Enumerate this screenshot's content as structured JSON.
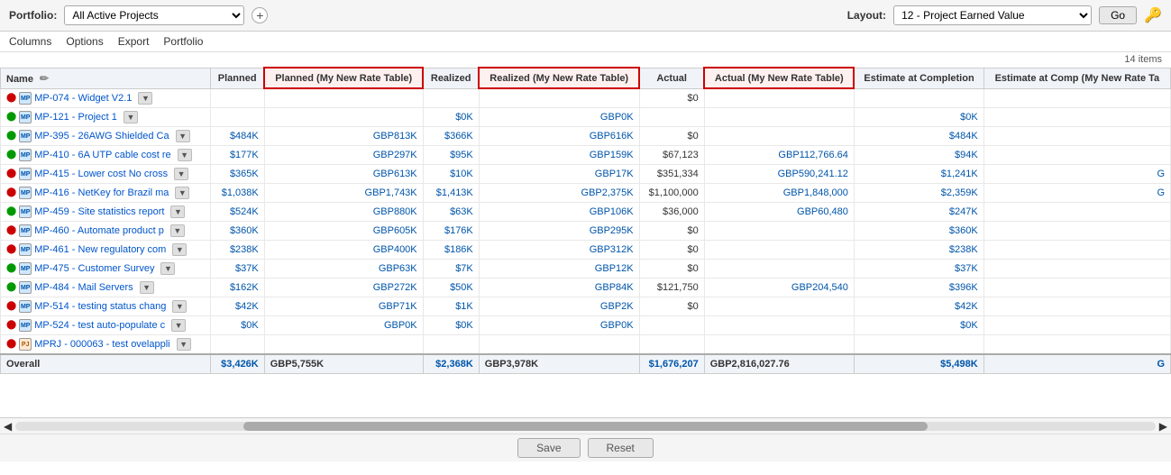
{
  "topBar": {
    "portfolioLabel": "Portfolio:",
    "portfolioValue": "All Active Projects",
    "layoutLabel": "Layout:",
    "layoutValue": "12 - Project Earned Value",
    "goLabel": "Go",
    "plusTitle": "Add"
  },
  "toolbar": {
    "items": [
      "Columns",
      "Options",
      "Export",
      "Portfolio"
    ]
  },
  "itemsCount": "14 items",
  "tableHeaders": {
    "name": "Name",
    "planned": "Planned",
    "plannedMyNewRate": "Planned (My New Rate Table)",
    "realized": "Realized",
    "realizedMyNewRate": "Realized (My New Rate Table)",
    "actual": "Actual",
    "actualMyNewRate": "Actual (My New Rate Table)",
    "estimateAtCompletion": "Estimate at Completion",
    "estimateAtCompletionMyNewRate": "Estimate at Comp (My New Rate Ta"
  },
  "rows": [
    {
      "id": "MP-074",
      "name": "MP-074 - Widget V2.1",
      "iconType": "mp",
      "dotColor": "red",
      "planned": "",
      "plannedMyNewRate": "",
      "realized": "",
      "realizedMyNewRate": "",
      "actual": "$0",
      "actualMyNewRate": "",
      "eac": "",
      "eacMNRT": ""
    },
    {
      "id": "MP-121",
      "name": "MP-121 - Project 1",
      "iconType": "mp",
      "dotColor": "green",
      "planned": "",
      "plannedMyNewRate": "",
      "realized": "$0K",
      "realizedMyNewRate": "GBP0K",
      "actual": "",
      "actualMyNewRate": "",
      "eac": "$0K",
      "eacMNRT": ""
    },
    {
      "id": "MP-395",
      "name": "MP-395 - 26AWG Shielded Ca",
      "iconType": "mp",
      "dotColor": "green",
      "planned": "$484K",
      "plannedMyNewRate": "GBP813K",
      "realized": "$366K",
      "realizedMyNewRate": "GBP616K",
      "actual": "$0",
      "actualMyNewRate": "",
      "eac": "$484K",
      "eacMNRT": ""
    },
    {
      "id": "MP-410",
      "name": "MP-410 - 6A UTP cable cost re",
      "iconType": "mp",
      "dotColor": "green",
      "planned": "$177K",
      "plannedMyNewRate": "GBP297K",
      "realized": "$95K",
      "realizedMyNewRate": "GBP159K",
      "actual": "$67,123",
      "actualMyNewRate": "GBP112,766.64",
      "eac": "$94K",
      "eacMNRT": ""
    },
    {
      "id": "MP-415",
      "name": "MP-415 - Lower cost No cross",
      "iconType": "mp",
      "dotColor": "red",
      "planned": "$365K",
      "plannedMyNewRate": "GBP613K",
      "realized": "$10K",
      "realizedMyNewRate": "GBP17K",
      "actual": "$351,334",
      "actualMyNewRate": "GBP590,241.12",
      "eac": "$1,241K",
      "eacMNRT": "G"
    },
    {
      "id": "MP-416",
      "name": "MP-416 - NetKey for Brazil ma",
      "iconType": "mp",
      "dotColor": "red",
      "planned": "$1,038K",
      "plannedMyNewRate": "GBP1,743K",
      "realized": "$1,413K",
      "realizedMyNewRate": "GBP2,375K",
      "actual": "$1,100,000",
      "actualMyNewRate": "GBP1,848,000",
      "eac": "$2,359K",
      "eacMNRT": "G"
    },
    {
      "id": "MP-459",
      "name": "MP-459 - Site statistics report",
      "iconType": "mp",
      "dotColor": "green",
      "planned": "$524K",
      "plannedMyNewRate": "GBP880K",
      "realized": "$63K",
      "realizedMyNewRate": "GBP106K",
      "actual": "$36,000",
      "actualMyNewRate": "GBP60,480",
      "eac": "$247K",
      "eacMNRT": ""
    },
    {
      "id": "MP-460",
      "name": "MP-460 - Automate product p",
      "iconType": "mp",
      "dotColor": "red",
      "planned": "$360K",
      "plannedMyNewRate": "GBP605K",
      "realized": "$176K",
      "realizedMyNewRate": "GBP295K",
      "actual": "$0",
      "actualMyNewRate": "",
      "eac": "$360K",
      "eacMNRT": ""
    },
    {
      "id": "MP-461",
      "name": "MP-461 - New regulatory com",
      "iconType": "mp",
      "dotColor": "red",
      "planned": "$238K",
      "plannedMyNewRate": "GBP400K",
      "realized": "$186K",
      "realizedMyNewRate": "GBP312K",
      "actual": "$0",
      "actualMyNewRate": "",
      "eac": "$238K",
      "eacMNRT": ""
    },
    {
      "id": "MP-475",
      "name": "MP-475 - Customer Survey",
      "iconType": "mp",
      "dotColor": "green",
      "planned": "$37K",
      "plannedMyNewRate": "GBP63K",
      "realized": "$7K",
      "realizedMyNewRate": "GBP12K",
      "actual": "$0",
      "actualMyNewRate": "",
      "eac": "$37K",
      "eacMNRT": ""
    },
    {
      "id": "MP-484",
      "name": "MP-484 - Mail Servers",
      "iconType": "mp",
      "dotColor": "green",
      "planned": "$162K",
      "plannedMyNewRate": "GBP272K",
      "realized": "$50K",
      "realizedMyNewRate": "GBP84K",
      "actual": "$121,750",
      "actualMyNewRate": "GBP204,540",
      "eac": "$396K",
      "eacMNRT": ""
    },
    {
      "id": "MP-514",
      "name": "MP-514 - testing status chang",
      "iconType": "mp",
      "dotColor": "red",
      "planned": "$42K",
      "plannedMyNewRate": "GBP71K",
      "realized": "$1K",
      "realizedMyNewRate": "GBP2K",
      "actual": "$0",
      "actualMyNewRate": "",
      "eac": "$42K",
      "eacMNRT": ""
    },
    {
      "id": "MP-524",
      "name": "MP-524 - test auto-populate c",
      "iconType": "mp",
      "dotColor": "red",
      "planned": "$0K",
      "plannedMyNewRate": "GBP0K",
      "realized": "$0K",
      "realizedMyNewRate": "GBP0K",
      "actual": "",
      "actualMyNewRate": "",
      "eac": "$0K",
      "eacMNRT": ""
    },
    {
      "id": "MPRJ-000063",
      "name": "MPRJ - 000063 - test ovelappli",
      "iconType": "prj",
      "dotColor": "red",
      "planned": "",
      "plannedMyNewRate": "",
      "realized": "",
      "realizedMyNewRate": "",
      "actual": "",
      "actualMyNewRate": "",
      "eac": "",
      "eacMNRT": ""
    }
  ],
  "footer": {
    "label": "Overall",
    "planned": "$3,426K",
    "plannedMyNewRate": "GBP5,755K",
    "realized": "$2,368K",
    "realizedMyNewRate": "GBP3,978K",
    "actual": "$1,676,207",
    "actualMyNewRate": "GBP2,816,027.76",
    "eac": "$5,498K",
    "eacMNRT": "G"
  },
  "buttons": {
    "save": "Save",
    "reset": "Reset"
  }
}
